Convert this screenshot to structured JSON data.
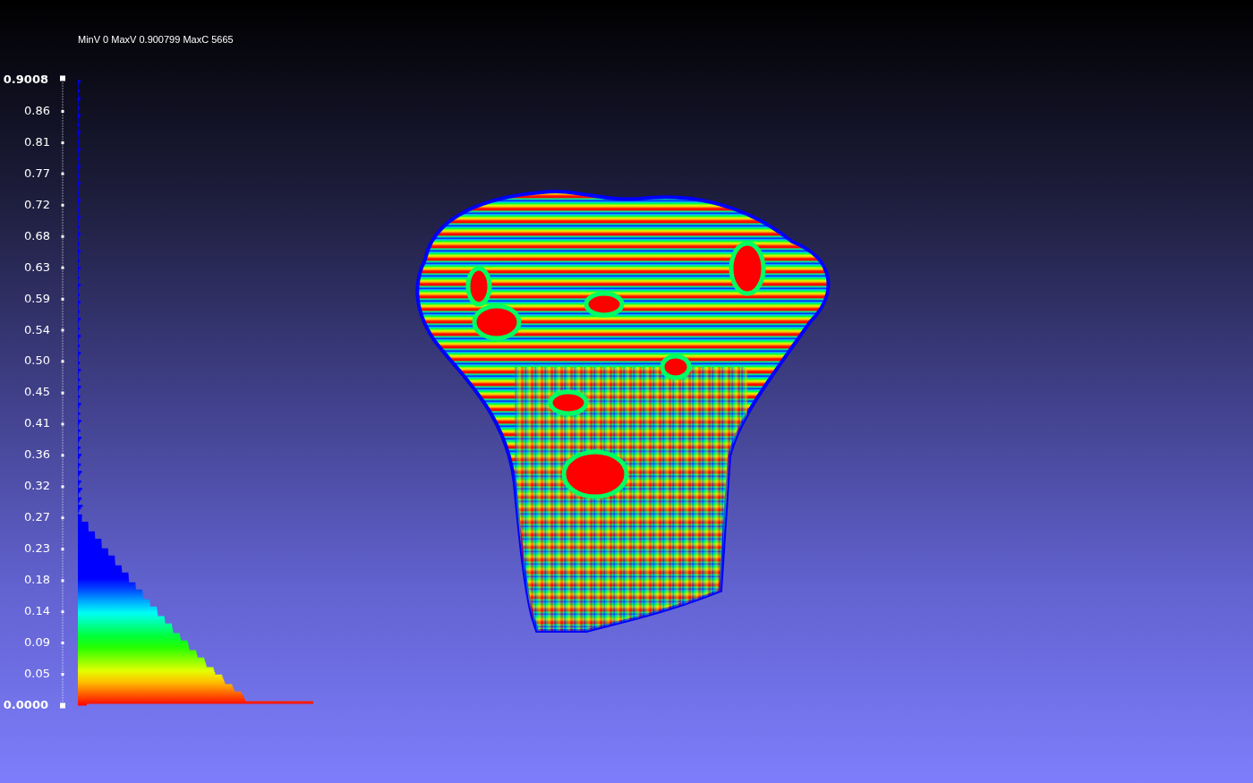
{
  "info": "MinV 0 MaxV 0.900799 MaxC 5665",
  "scale": {
    "ticks": [
      "0.9008",
      "0.86",
      "0.81",
      "0.77",
      "0.72",
      "0.68",
      "0.63",
      "0.59",
      "0.54",
      "0.50",
      "0.45",
      "0.41",
      "0.36",
      "0.32",
      "0.27",
      "0.23",
      "0.18",
      "0.14",
      "0.09",
      "0.05",
      "0.0000"
    ]
  }
}
